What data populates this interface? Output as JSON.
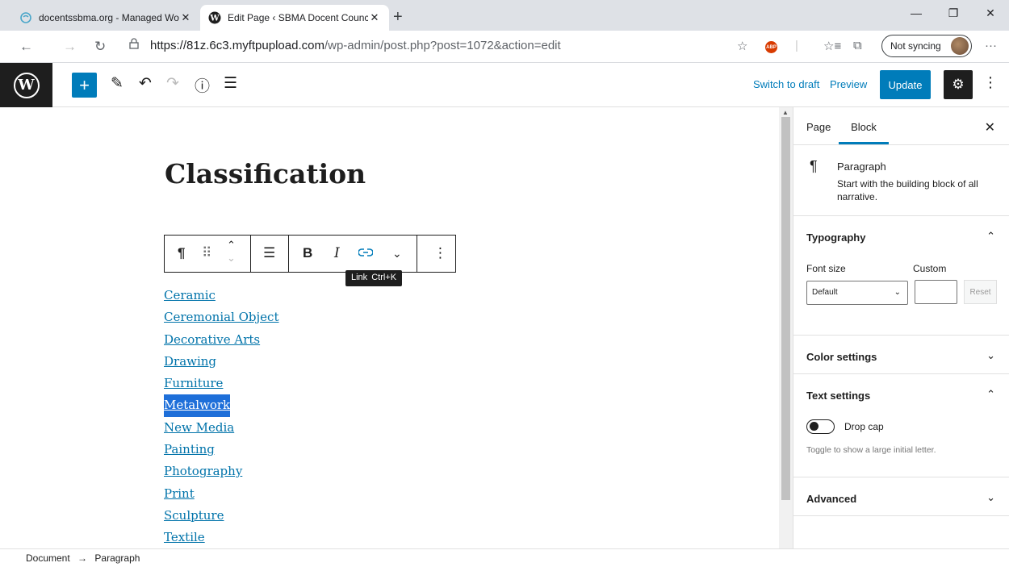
{
  "browser": {
    "tabs": [
      {
        "title": "docentssbma.org - Managed Wo",
        "active": false
      },
      {
        "title": "Edit Page ‹ SBMA Docent Counc",
        "active": true
      }
    ],
    "new_tab": "+",
    "window_controls": [
      "—",
      "❐",
      "✕"
    ],
    "url": {
      "host": "https://81z.6c3.myftpupload.com",
      "path": "/wp-admin/post.php?post=1072&action=edit"
    },
    "sync_label": "Not syncing",
    "abp_label": "ABP"
  },
  "wp_toolbar": {
    "add_label": "+",
    "switch_to_draft": "Switch to draft",
    "preview": "Preview",
    "update": "Update"
  },
  "editor": {
    "title": "Classification",
    "tooltip": {
      "label": "Link",
      "shortcut": "Ctrl+K"
    },
    "links": [
      "Ceramic",
      "Ceremonial Object",
      "Decorative Arts",
      "Drawing",
      "Furniture",
      "Metalwork",
      "New Media",
      "Painting",
      "Photography",
      "Print",
      "Sculpture",
      "Textile"
    ],
    "selected_link": "Metalwork"
  },
  "sidebar": {
    "tabs": [
      "Page",
      "Block"
    ],
    "active_tab": "Block",
    "block": {
      "name": "Paragraph",
      "description": "Start with the building block of all narrative."
    },
    "typography": {
      "heading": "Typography",
      "font_size_label": "Font size",
      "custom_label": "Custom",
      "font_size_value": "Default",
      "reset": "Reset"
    },
    "color_settings": "Color settings",
    "text_settings": {
      "heading": "Text settings",
      "drop_cap": "Drop cap",
      "drop_cap_enabled": false,
      "help": "Toggle to show a large initial letter."
    },
    "advanced": "Advanced"
  },
  "footer": {
    "crumbs": [
      "Document",
      "Paragraph"
    ],
    "separator": "→"
  },
  "colors": {
    "accent": "#007cba",
    "dark": "#1e1e1e",
    "link": "#0073aa",
    "selection": "#1e6fd9"
  }
}
